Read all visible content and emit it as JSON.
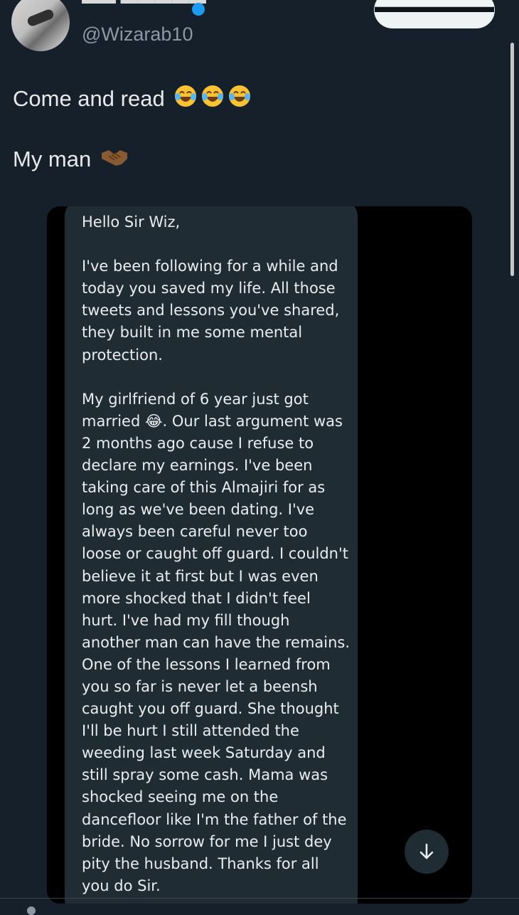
{
  "author": {
    "username": "@Wizarab10"
  },
  "tweet": {
    "line1": "Come and read",
    "line2": "My man"
  },
  "message": {
    "text": "Hello Sir Wiz,\n\nI've been following for a while and today you saved my life. All those tweets and lessons you've shared, they built in me some mental protection.\n\nMy girlfriend of 6 year just got married 😂. Our last argument was 2 months ago cause I refuse to declare my earnings. I've been taking care of this Almajiri for as long as we've been dating. I've always been careful never too loose or caught off guard. I couldn't believe it at first but I was even more shocked that I didn't feel hurt. I've had my fill though another man can have the remains. One of the lessons I learned from you so far is never let a beensh caught you off guard. She thought I'll be hurt I still attended the weeding last week Saturday and still spray some cash. Mama was shocked seeing me on the dancefloor like I'm the father of the bride. No sorrow for me I just dey pity the husband. Thanks for all you do Sir."
  },
  "icons": {
    "laugh": "face-with-tears-of-joy-icon",
    "handshake": "handshake-icon",
    "scroll_down": "arrow-down-icon"
  },
  "colors": {
    "background": "#15202b",
    "bubble": "#202c33",
    "verified": "#1d9bf0"
  }
}
